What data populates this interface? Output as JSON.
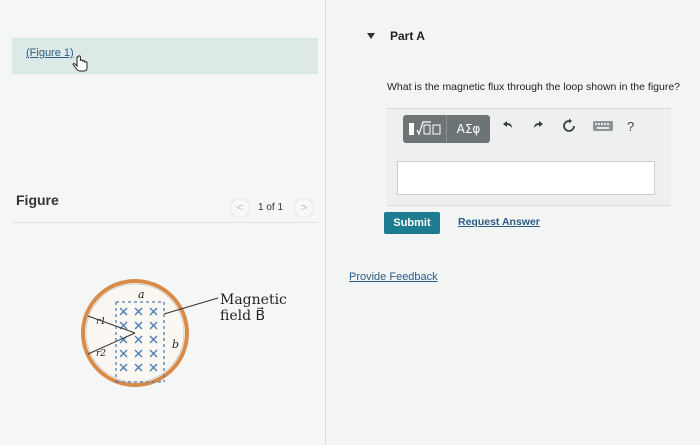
{
  "left": {
    "figure_link": "(Figure 1)",
    "figure_label": "Figure",
    "pager": {
      "prev": "<",
      "text": "1 of 1",
      "next": ">"
    }
  },
  "figure": {
    "label_a": "a",
    "label_b": "b",
    "label_r1": "r1",
    "label_r2": "r2",
    "field_label_line1": "Magnetic",
    "field_label_line2": "field B⃗"
  },
  "part": {
    "title": "Part A",
    "question": "What is the magnetic flux through the loop shown in the figure?"
  },
  "toolbar": {
    "templates_label": "▮√□",
    "greek_label": "ΑΣφ",
    "help_label": "?"
  },
  "answer": {
    "value": ""
  },
  "actions": {
    "submit": "Submit",
    "request_answer": "Request Answer",
    "provide_feedback": "Provide Feedback"
  },
  "colors": {
    "submit_bg": "#1d7c8f",
    "link": "#2a5d86",
    "figure_link_bg": "#dce9e6",
    "loop_ring": "#d98c4a",
    "field_x": "#4a7fb8"
  }
}
